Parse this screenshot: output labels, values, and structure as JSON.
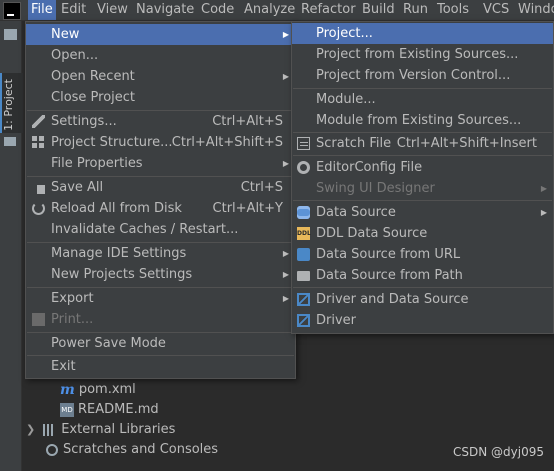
{
  "menubar": {
    "items": [
      "File",
      "Edit",
      "View",
      "Navigate",
      "Code",
      "Analyze",
      "Refactor",
      "Build",
      "Run",
      "Tools",
      "VCS",
      "Windo"
    ]
  },
  "sidebar": {
    "tab_label": "1: Project"
  },
  "file_menu": {
    "new": "New",
    "open": "Open...",
    "open_recent": "Open Recent",
    "close_project": "Close Project",
    "settings": "Settings...",
    "settings_shortcut": "Ctrl+Alt+S",
    "project_structure": "Project Structure...",
    "project_structure_shortcut": "Ctrl+Alt+Shift+S",
    "file_properties": "File Properties",
    "save_all": "Save All",
    "save_all_shortcut": "Ctrl+S",
    "reload": "Reload All from Disk",
    "reload_shortcut": "Ctrl+Alt+Y",
    "invalidate": "Invalidate Caches / Restart...",
    "manage_ide": "Manage IDE Settings",
    "new_projects_settings": "New Projects Settings",
    "export": "Export",
    "print": "Print...",
    "power_save": "Power Save Mode",
    "exit": "Exit"
  },
  "new_submenu": {
    "project": "Project...",
    "from_existing": "Project from Existing Sources...",
    "from_vcs": "Project from Version Control...",
    "module": "Module...",
    "module_existing": "Module from Existing Sources...",
    "scratch": "Scratch File",
    "scratch_shortcut": "Ctrl+Alt+Shift+Insert",
    "editorconfig": "EditorConfig File",
    "swing": "Swing UI Designer",
    "data_source": "Data Source",
    "ddl": "DDL Data Source",
    "from_url": "Data Source from URL",
    "from_path": "Data Source from Path",
    "driver_ds": "Driver and Data Source",
    "driver": "Driver"
  },
  "tree": {
    "pom": "pom.xml",
    "readme": "README.md",
    "external_libraries": "External Libraries",
    "scratches": "Scratches and Consoles"
  },
  "watermark": "CSDN @dyj095"
}
